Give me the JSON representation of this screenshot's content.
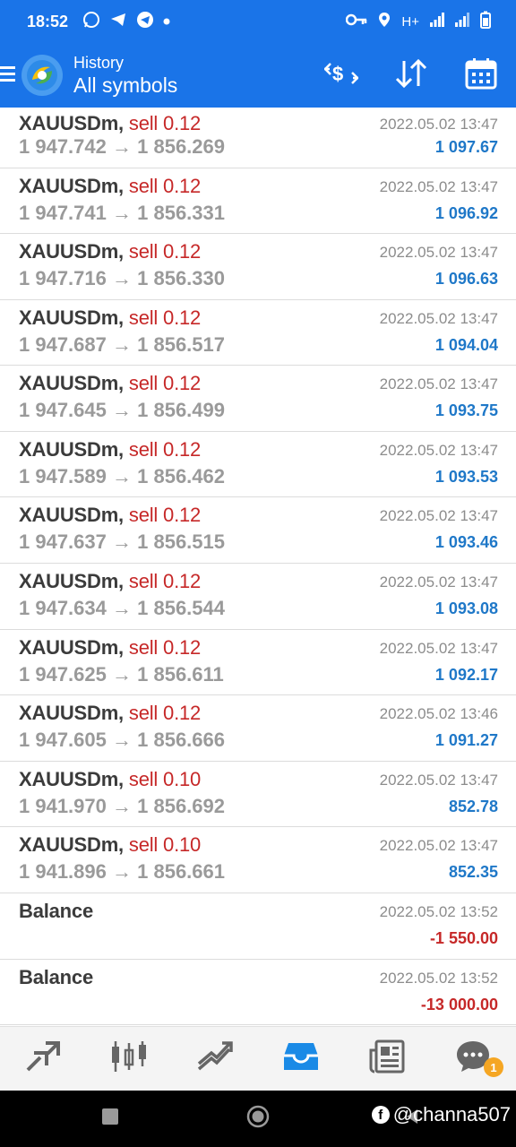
{
  "status_bar": {
    "time": "18:52",
    "network": "H+"
  },
  "header": {
    "subtitle": "History",
    "title": "All symbols"
  },
  "trades": [
    {
      "symbol": "XAUUSDm,",
      "side": "sell 0.12",
      "open": "1 947.742",
      "close": "1 856.269",
      "date": "2022.05.02 13:47",
      "profit": "1 097.67"
    },
    {
      "symbol": "XAUUSDm,",
      "side": "sell 0.12",
      "open": "1 947.741",
      "close": "1 856.331",
      "date": "2022.05.02 13:47",
      "profit": "1 096.92"
    },
    {
      "symbol": "XAUUSDm,",
      "side": "sell 0.12",
      "open": "1 947.716",
      "close": "1 856.330",
      "date": "2022.05.02 13:47",
      "profit": "1 096.63"
    },
    {
      "symbol": "XAUUSDm,",
      "side": "sell 0.12",
      "open": "1 947.687",
      "close": "1 856.517",
      "date": "2022.05.02 13:47",
      "profit": "1 094.04"
    },
    {
      "symbol": "XAUUSDm,",
      "side": "sell 0.12",
      "open": "1 947.645",
      "close": "1 856.499",
      "date": "2022.05.02 13:47",
      "profit": "1 093.75"
    },
    {
      "symbol": "XAUUSDm,",
      "side": "sell 0.12",
      "open": "1 947.589",
      "close": "1 856.462",
      "date": "2022.05.02 13:47",
      "profit": "1 093.53"
    },
    {
      "symbol": "XAUUSDm,",
      "side": "sell 0.12",
      "open": "1 947.637",
      "close": "1 856.515",
      "date": "2022.05.02 13:47",
      "profit": "1 093.46"
    },
    {
      "symbol": "XAUUSDm,",
      "side": "sell 0.12",
      "open": "1 947.634",
      "close": "1 856.544",
      "date": "2022.05.02 13:47",
      "profit": "1 093.08"
    },
    {
      "symbol": "XAUUSDm,",
      "side": "sell 0.12",
      "open": "1 947.625",
      "close": "1 856.611",
      "date": "2022.05.02 13:47",
      "profit": "1 092.17"
    },
    {
      "symbol": "XAUUSDm,",
      "side": "sell 0.12",
      "open": "1 947.605",
      "close": "1 856.666",
      "date": "2022.05.02 13:46",
      "profit": "1 091.27"
    },
    {
      "symbol": "XAUUSDm,",
      "side": "sell 0.10",
      "open": "1 941.970",
      "close": "1 856.692",
      "date": "2022.05.02 13:47",
      "profit": "852.78"
    },
    {
      "symbol": "XAUUSDm,",
      "side": "sell 0.10",
      "open": "1 941.896",
      "close": "1 856.661",
      "date": "2022.05.02 13:47",
      "profit": "852.35"
    }
  ],
  "balances": [
    {
      "label": "Balance",
      "date": "2022.05.02 13:52",
      "amount": "-1 550.00"
    },
    {
      "label": "Balance",
      "date": "2022.05.02 13:52",
      "amount": "-13 000.00"
    }
  ],
  "arrow": "→",
  "tabbar": {
    "chat_badge": "1",
    "active_tab": "history"
  },
  "watermark": "@channa507",
  "colors": {
    "header": "#1a74e8",
    "sell": "#c62828",
    "profit": "#1f78c8",
    "loss": "#c62828",
    "active_tab": "#1a8ae6",
    "badge": "#f5a623"
  },
  "icons": {
    "header": [
      "menu-icon",
      "metatrader-logo",
      "currency-exchange-icon",
      "sort-icon",
      "calendar-icon"
    ],
    "tabs": [
      "quotes-icon",
      "chart-icon",
      "trade-icon",
      "history-icon",
      "news-icon",
      "chat-icon"
    ],
    "nav": [
      "recents-icon",
      "home-icon",
      "back-icon"
    ]
  }
}
